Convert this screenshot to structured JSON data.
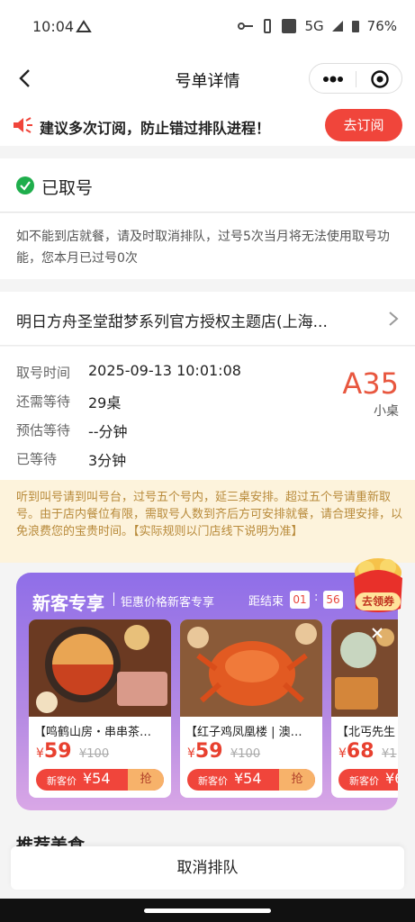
{
  "status_bar": {
    "time": "10:04",
    "network": "5G",
    "battery": "76%"
  },
  "nav": {
    "title": "号单详情"
  },
  "notice": {
    "text": "建议多次订阅，防止错过排队进程！",
    "button": "去订阅"
  },
  "queue_status": {
    "label": "已取号"
  },
  "warning": {
    "text": "如不能到店就餐，请及时取消排队，过号5次当月将无法使用取号功能，您本月已过号0次"
  },
  "store": {
    "name": "明日方舟圣堂甜梦系列官方授权主题店(上海..."
  },
  "ticket": {
    "rows": [
      {
        "label": "取号时间",
        "value": "2025-09-13 10:01:08"
      },
      {
        "label": "还需等待",
        "value": "29桌"
      },
      {
        "label": "预估等待",
        "value": "--分钟"
      },
      {
        "label": "已等待",
        "value": "3分钟"
      }
    ],
    "number": "A35",
    "table_size": "小桌"
  },
  "rule": {
    "text": "听到叫号请到叫号台，过号五个号内，延三桌安排。超过五个号请重新取号。由于店内餐位有限，需取号人数到齐后方可安排就餐，请合理安排，以免浪费您的宝贵时间。【实际规则以门店线下说明为准】"
  },
  "promo": {
    "title": "新客专享",
    "subtitle": "钜惠价格新客专享",
    "countdown_label": "距结束",
    "countdown": [
      "01",
      "56"
    ],
    "coupon_label": "去领券",
    "products": [
      {
        "name": "【鸣鹤山房・串串茶…",
        "price": "59",
        "original": "¥100",
        "new_label": "新客价",
        "new_price": "¥54",
        "grab": "抢"
      },
      {
        "name": "【红子鸡凤凰楼 | 澳…",
        "price": "59",
        "original": "¥100",
        "new_label": "新客价",
        "new_price": "¥54",
        "grab": "抢"
      },
      {
        "name": "【北丐先生",
        "price": "68",
        "original": "¥1",
        "new_label": "新客价",
        "new_price": "¥6",
        "grab": ""
      }
    ],
    "colors": {
      "accent": "#f0453b",
      "gradient_top": "#8f6ee8"
    }
  },
  "recommend": {
    "title": "推荐美食"
  },
  "cancel": {
    "label": "取消排队"
  }
}
